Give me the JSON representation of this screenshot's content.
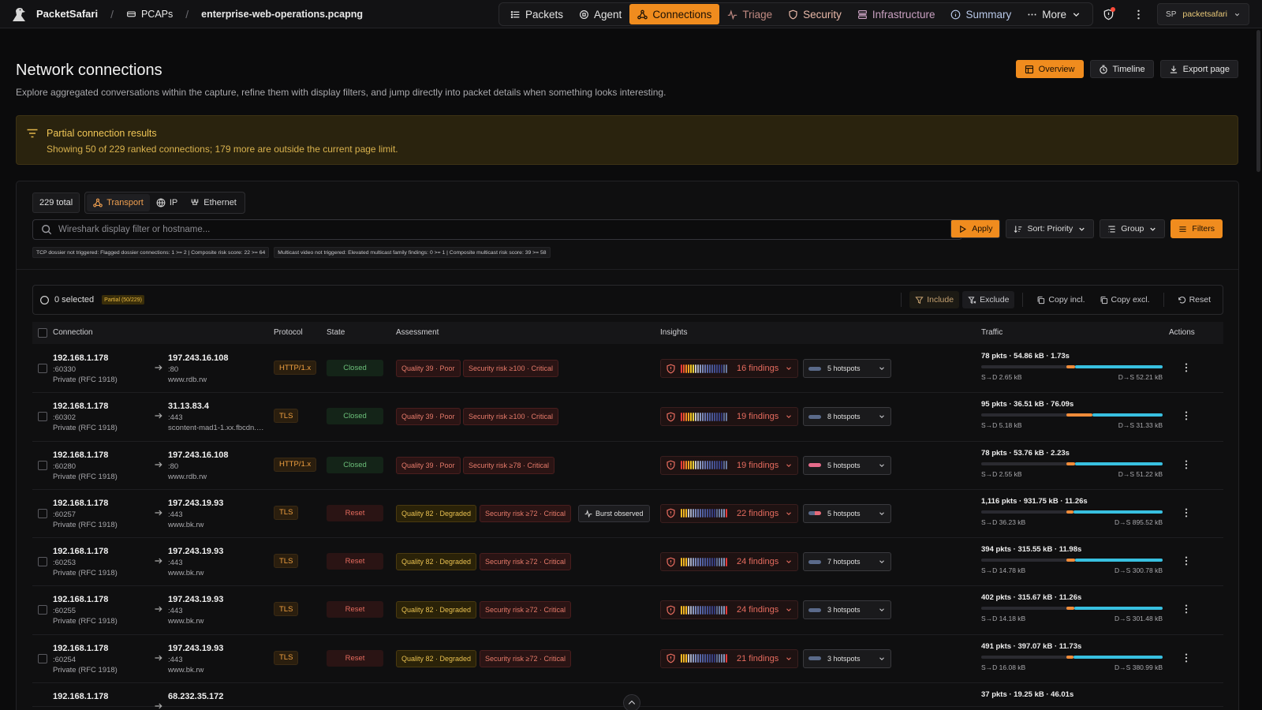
{
  "app": {
    "name": "PacketSafari"
  },
  "breadcrumb": {
    "pcaps": "PCAPs",
    "file": "enterprise-web-operations.pcapng"
  },
  "nav": [
    {
      "label": "Packets",
      "icon": "list-icon"
    },
    {
      "label": "Agent",
      "icon": "agent-icon"
    },
    {
      "label": "Connections",
      "icon": "network-icon",
      "active": true
    },
    {
      "label": "Triage",
      "icon": "pulse-icon"
    },
    {
      "label": "Security",
      "icon": "shield-icon"
    },
    {
      "label": "Infrastructure",
      "icon": "server-icon"
    },
    {
      "label": "Summary",
      "icon": "info-icon"
    },
    {
      "label": "More",
      "icon": "dots-icon"
    }
  ],
  "user": {
    "initials": "SP",
    "name": "packetsafari"
  },
  "page": {
    "title": "Network connections",
    "description": "Explore aggregated conversations within the capture, refine them with display filters, and jump directly into packet details when something looks interesting.",
    "actions": {
      "overview": "Overview",
      "timeline": "Timeline",
      "export": "Export page"
    }
  },
  "alert": {
    "title": "Partial connection results",
    "body": "Showing 50 of 229 ranked connections; 179 more are outside the current page limit."
  },
  "toolbar": {
    "total": "229 total",
    "layers": [
      "Transport",
      "IP",
      "Ethernet"
    ],
    "search_placeholder": "Wireshark display filter or hostname...",
    "apply": "Apply",
    "sort": "Sort: Priority",
    "group": "Group",
    "filters": "Filters",
    "notes": [
      "TCP dossier not triggered: Flagged dossier connections: 1 >= 2 | Composite risk score: 22 >= 64",
      "Multicast video not triggered: Elevated multicast family findings: 0 >= 1 | Composite multicast risk score: 39 >= 58"
    ]
  },
  "selection": {
    "count": "0 selected",
    "badge": "Partial (50/229)",
    "include": "Include",
    "exclude": "Exclude",
    "copy_incl": "Copy incl.",
    "copy_excl": "Copy excl.",
    "reset": "Reset"
  },
  "columns": {
    "connection": "Connection",
    "protocol": "Protocol",
    "state": "State",
    "assessment": "Assessment",
    "insights": "Insights",
    "traffic": "Traffic",
    "actions": "Actions"
  },
  "colors": {
    "accent": "#f08c1e",
    "rx": "#38c0e0",
    "tx": "#f08c3a",
    "danger": "#e56b5e",
    "ok": "#6cc07a"
  },
  "rows": [
    {
      "src_ip": "192.168.1.178",
      "src_port": ":60330",
      "src_net": "Private (RFC 1918)",
      "dst_ip": "197.243.16.108",
      "dst_port": ":80",
      "dst_host": "www.rdb.rw",
      "protocol": "HTTP/1.x",
      "state": "Closed",
      "quality": "Quality 39 · Poor",
      "quality_level": "poor",
      "risk": "Security risk ≥100 · Critical",
      "burst": "",
      "findings": "16 findings",
      "hotspots": "5 hotspots",
      "hs_style": "normal",
      "traffic": "78 pkts · 54.86 kB · 1.73s",
      "s_to_d": "S→D 2.65 kB",
      "d_to_s": "D→S 52.21 kB",
      "tx_share": 0.048
    },
    {
      "src_ip": "192.168.1.178",
      "src_port": ":60302",
      "src_net": "Private (RFC 1918)",
      "dst_ip": "31.13.83.4",
      "dst_port": ":443",
      "dst_host": "scontent-mad1-1.xx.fbcdn.net",
      "protocol": "TLS",
      "state": "Closed",
      "quality": "Quality 39 · Poor",
      "quality_level": "poor",
      "risk": "Security risk ≥100 · Critical",
      "burst": "",
      "findings": "19 findings",
      "hotspots": "8 hotspots",
      "hs_style": "normal",
      "traffic": "95 pkts · 36.51 kB · 76.09s",
      "s_to_d": "S→D 5.18 kB",
      "d_to_s": "D→S 31.33 kB",
      "tx_share": 0.142
    },
    {
      "src_ip": "192.168.1.178",
      "src_port": ":60280",
      "src_net": "Private (RFC 1918)",
      "dst_ip": "197.243.16.108",
      "dst_port": ":80",
      "dst_host": "www.rdb.rw",
      "protocol": "HTTP/1.x",
      "state": "Closed",
      "quality": "Quality 39 · Poor",
      "quality_level": "poor",
      "risk": "Security risk ≥78 · Critical",
      "burst": "",
      "findings": "19 findings",
      "hotspots": "5 hotspots",
      "hs_style": "warn",
      "traffic": "78 pkts · 53.76 kB · 2.23s",
      "s_to_d": "S→D 2.55 kB",
      "d_to_s": "D→S 51.22 kB",
      "tx_share": 0.047
    },
    {
      "src_ip": "192.168.1.178",
      "src_port": ":60257",
      "src_net": "Private (RFC 1918)",
      "dst_ip": "197.243.19.93",
      "dst_port": ":443",
      "dst_host": "www.bk.rw",
      "protocol": "TLS",
      "state": "Reset",
      "quality": "Quality 82 · Degraded",
      "quality_level": "degraded",
      "risk": "Security risk ≥72 · Critical",
      "burst": "Burst observed",
      "findings": "22 findings",
      "hotspots": "5 hotspots",
      "hs_style": "mix",
      "traffic": "1,116 pkts · 931.75 kB · 11.26s",
      "s_to_d": "S→D 36.23 kB",
      "d_to_s": "D→S 895.52 kB",
      "tx_share": 0.039
    },
    {
      "src_ip": "192.168.1.178",
      "src_port": ":60253",
      "src_net": "Private (RFC 1918)",
      "dst_ip": "197.243.19.93",
      "dst_port": ":443",
      "dst_host": "www.bk.rw",
      "protocol": "TLS",
      "state": "Reset",
      "quality": "Quality 82 · Degraded",
      "quality_level": "degraded",
      "risk": "Security risk ≥72 · Critical",
      "burst": "",
      "findings": "24 findings",
      "hotspots": "7 hotspots",
      "hs_style": "normal",
      "traffic": "394 pkts · 315.55 kB · 11.98s",
      "s_to_d": "S→D 14.78 kB",
      "d_to_s": "D→S 300.78 kB",
      "tx_share": 0.047
    },
    {
      "src_ip": "192.168.1.178",
      "src_port": ":60255",
      "src_net": "Private (RFC 1918)",
      "dst_ip": "197.243.19.93",
      "dst_port": ":443",
      "dst_host": "www.bk.rw",
      "protocol": "TLS",
      "state": "Reset",
      "quality": "Quality 82 · Degraded",
      "quality_level": "degraded",
      "risk": "Security risk ≥72 · Critical",
      "burst": "",
      "findings": "24 findings",
      "hotspots": "3 hotspots",
      "hs_style": "normal",
      "traffic": "402 pkts · 315.67 kB · 11.26s",
      "s_to_d": "S→D 14.18 kB",
      "d_to_s": "D→S 301.48 kB",
      "tx_share": 0.045
    },
    {
      "src_ip": "192.168.1.178",
      "src_port": ":60254",
      "src_net": "Private (RFC 1918)",
      "dst_ip": "197.243.19.93",
      "dst_port": ":443",
      "dst_host": "www.bk.rw",
      "protocol": "TLS",
      "state": "Reset",
      "quality": "Quality 82 · Degraded",
      "quality_level": "degraded",
      "risk": "Security risk ≥72 · Critical",
      "burst": "",
      "findings": "21 findings",
      "hotspots": "3 hotspots",
      "hs_style": "normal",
      "traffic": "491 pkts · 397.07 kB · 11.73s",
      "s_to_d": "S→D 16.08 kB",
      "d_to_s": "D→S 380.99 kB",
      "tx_share": 0.04
    },
    {
      "src_ip": "192.168.1.178",
      "src_port": "",
      "src_net": "",
      "dst_ip": "68.232.35.172",
      "dst_port": "",
      "dst_host": "",
      "protocol": "",
      "state": "",
      "quality": "",
      "quality_level": "",
      "risk": "",
      "burst": "",
      "findings": "",
      "hotspots": "",
      "hs_style": "",
      "traffic": "37 pkts · 19.25 kB · 46.01s",
      "s_to_d": "",
      "d_to_s": "",
      "tx_share": 0
    }
  ]
}
